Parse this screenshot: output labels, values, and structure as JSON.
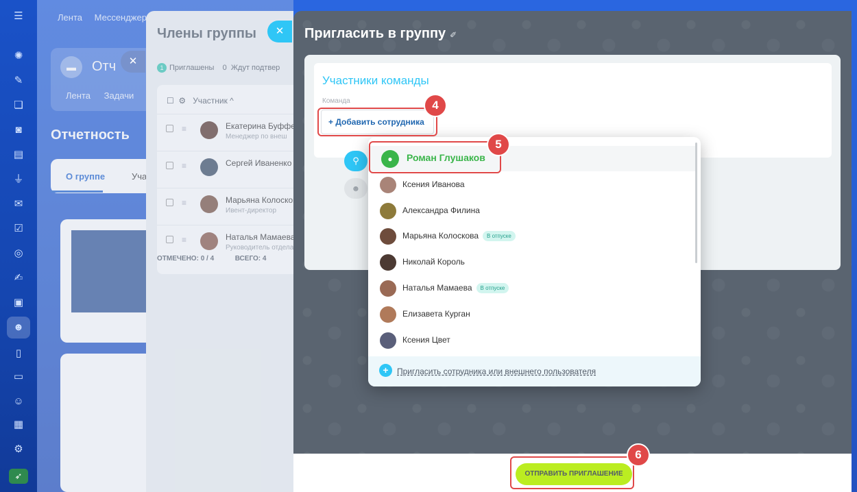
{
  "rail": {
    "icons": [
      "menu-icon",
      "pulse-icon",
      "tasks-icon",
      "chat-icon",
      "disk-icon",
      "docs-icon",
      "crm-icon",
      "mail-icon",
      "checklist-icon",
      "target-icon",
      "sign-icon",
      "contacts-icon",
      "groups-icon",
      "page-icon",
      "storage-icon",
      "robot-icon",
      "calendar-icon",
      "settings-icon",
      "rocket-icon"
    ]
  },
  "app": {
    "top_links": [
      "Лента",
      "Мессенджер"
    ],
    "group_card_title": "Отч",
    "group_card_links": [
      "Лента",
      "Задачи"
    ],
    "page_title": "Отчетность",
    "tabs": [
      "О группе",
      "Уча"
    ]
  },
  "members": {
    "title": "Члены группы",
    "filter_invited_count": "1",
    "filter_invited": "Приглашены",
    "filter_waiting_count": "0",
    "filter_waiting": "Ждут подтвер",
    "column_header": "Участник ^",
    "rows": [
      {
        "name": "Екатерина Буффе",
        "position": "Менеджер по внеш"
      },
      {
        "name": "Сергей Иваненко",
        "position": ""
      },
      {
        "name": "Марьяна Колоскова",
        "position": "Ивент-директор"
      },
      {
        "name": "Наталья Мамаева",
        "position": "Руководитель отдела"
      }
    ],
    "marked": "ОТМЕЧЕНО: 0 / 4",
    "total": "ВСЕГО: 4"
  },
  "invite": {
    "title": "Пригласить в группу",
    "team_label": "Участники команды",
    "team_sub": "Команда",
    "add_button": "+ Добавить сотрудника",
    "send_button": "ОТПРАВИТЬ ПРИГЛАШЕНИЕ"
  },
  "dropdown": {
    "items": [
      {
        "name": "Роман Глушаков",
        "badge": "",
        "selected": true
      },
      {
        "name": "Ксения Иванова",
        "badge": "",
        "selected": false
      },
      {
        "name": "Александра Филина",
        "badge": "",
        "selected": false
      },
      {
        "name": "Марьяна Колоскова",
        "badge": "В отпуске",
        "selected": false
      },
      {
        "name": "Николай Король",
        "badge": "",
        "selected": false
      },
      {
        "name": "Наталья Мамаева",
        "badge": "В отпуске",
        "selected": false
      },
      {
        "name": "Елизавета Курган",
        "badge": "",
        "selected": false
      },
      {
        "name": "Ксения Цвет",
        "badge": "",
        "selected": false
      }
    ],
    "invite_link": "Пригласить сотрудника или внешнего пользователя"
  },
  "steps": [
    "4",
    "5",
    "6"
  ],
  "colors": {
    "accent": "#2fc6f6",
    "highlight": "#e04848",
    "send": "#bbed21",
    "selected_user": "#3ab54a"
  }
}
